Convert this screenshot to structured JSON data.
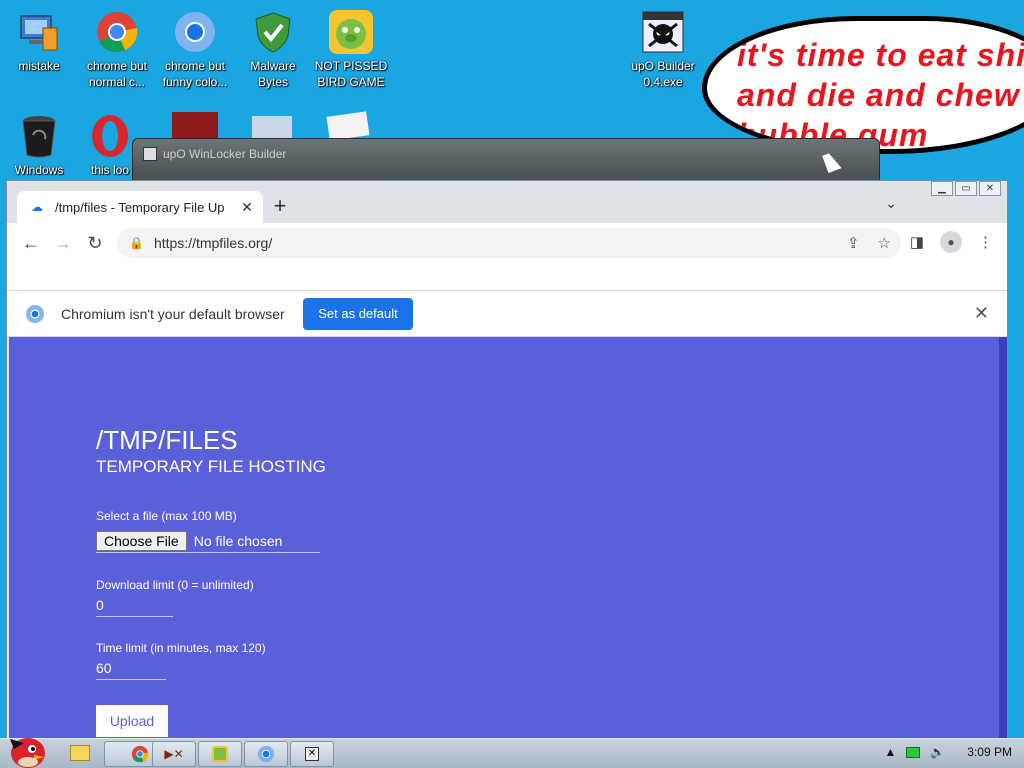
{
  "desktop": {
    "icons": [
      {
        "label": "mistake",
        "icon": "computer-program-icon"
      },
      {
        "label": "chrome but normal c...",
        "icon": "chrome-icon"
      },
      {
        "label": "chrome but funny colo...",
        "icon": "chrome-blue-icon"
      },
      {
        "label": "Malware Bytes",
        "icon": "shield-check-icon"
      },
      {
        "label": "NOT PISSED BIRD GAME",
        "icon": "green-pig-icon"
      },
      {
        "label": "upO Builder 0.4.exe",
        "icon": "skull-icon"
      },
      {
        "label": "Windows",
        "icon": "recycle-bin-icon"
      },
      {
        "label": "this loo",
        "icon": "opera-icon"
      }
    ],
    "bubble_text_line1": "it's time to eat shit",
    "bubble_text_line2": "and die and chew",
    "bubble_text_line3": "bubble gum"
  },
  "bg_window": {
    "title": "upO WinLocker Builder"
  },
  "browser": {
    "tab": {
      "title": "/tmp/files - Temporary File Up"
    },
    "address": "https://tmpfiles.org/",
    "infobar": {
      "message": "Chromium isn't your default browser",
      "button": "Set as default"
    }
  },
  "page": {
    "title": "/TMP/FILES",
    "subtitle": "TEMPORARY FILE HOSTING",
    "file_label": "Select a file (max 100 MB)",
    "choose_file": "Choose File",
    "no_file": "No file chosen",
    "download_label": "Download limit (0 = unlimited)",
    "download_value": "0",
    "time_label": "Time limit (in minutes, max 120)",
    "time_value": "60",
    "upload": "Upload"
  },
  "taskbar": {
    "items": [
      "explorer-icon",
      "chrome-icon",
      "media-icon",
      "pig-game-icon",
      "chrome-blue-icon",
      "skull-icon"
    ],
    "clock": "3:09 PM"
  },
  "colors": {
    "desktop": "#1aa6e0",
    "page_bg": "#5a5fda",
    "accent": "#1a73e8",
    "bubble_text": "#e8141e"
  }
}
